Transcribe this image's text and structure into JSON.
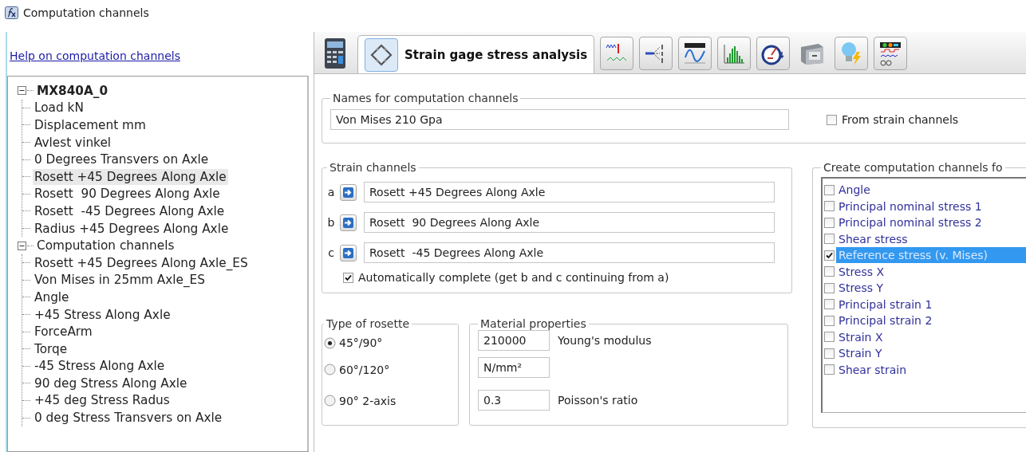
{
  "window": {
    "title": "Computation channels"
  },
  "help_link": "Help on computation channels",
  "tree": [
    {
      "label": "MX840A_0",
      "kind": "device",
      "expanded": true,
      "selected": false,
      "children": [
        {
          "label": "Load kN",
          "selected": false
        },
        {
          "label": "Displacement mm",
          "selected": false
        },
        {
          "label": "Avlest vinkel",
          "selected": false
        },
        {
          "label": "0 Degrees Transvers on Axle",
          "selected": false
        },
        {
          "label": "Rosett +45 Degrees Along Axle",
          "selected": true
        },
        {
          "label": "Rosett  90 Degrees Along Axle",
          "selected": false
        },
        {
          "label": "Rosett  -45 Degrees Along Axle",
          "selected": false
        },
        {
          "label": "Radius +45 Degrees Along Axle",
          "selected": false
        }
      ]
    },
    {
      "label": "Computation channels",
      "kind": "group",
      "expanded": true,
      "selected": false,
      "children": [
        {
          "label": "Rosett +45 Degrees Along Axle_ES",
          "selected": false
        },
        {
          "label": "Von Mises in 25mm Axle_ES",
          "selected": false
        },
        {
          "label": "Angle",
          "selected": false
        },
        {
          "label": "+45 Stress Along Axle",
          "selected": false
        },
        {
          "label": "ForceArm",
          "selected": false
        },
        {
          "label": "Torqe",
          "selected": false
        },
        {
          "label": "-45 Stress Along Axle",
          "selected": false
        },
        {
          "label": "90 deg Stress Along Axle",
          "selected": false
        },
        {
          "label": "+45 deg Stress Radus",
          "selected": false
        },
        {
          "label": "0 deg Stress Transvers on Axle",
          "selected": false
        }
      ]
    }
  ],
  "tabs": [
    {
      "kind": "icon",
      "selected": false
    },
    {
      "kind": "labeled",
      "label": "Strain gage stress analysis",
      "selected": true
    },
    {
      "kind": "icon",
      "selected": false
    },
    {
      "kind": "icon",
      "selected": false
    },
    {
      "kind": "icon",
      "selected": false
    },
    {
      "kind": "icon",
      "selected": false
    },
    {
      "kind": "icon",
      "selected": false
    },
    {
      "kind": "icon",
      "selected": false
    },
    {
      "kind": "icon",
      "selected": false
    },
    {
      "kind": "icon",
      "selected": false
    }
  ],
  "names": {
    "title": "Names for computation channels",
    "value": "Von Mises 210 Gpa",
    "from_strain": {
      "label": "From strain channels",
      "checked": false
    }
  },
  "strain_channels": {
    "title": "Strain channels",
    "rows": [
      {
        "letter": "a",
        "value": "Rosett +45 Degrees Along Axle"
      },
      {
        "letter": "b",
        "value": "Rosett  90 Degrees Along Axle"
      },
      {
        "letter": "c",
        "value": "Rosett  -45 Degrees Along Axle"
      }
    ],
    "auto_complete": {
      "label": "Automatically complete (get b and c continuing from a)",
      "checked": true
    }
  },
  "rosette": {
    "title": "Type of rosette",
    "options": [
      {
        "label": "45°/90°",
        "selected": true
      },
      {
        "label": "60°/120°",
        "selected": false
      },
      {
        "label": "90° 2-axis",
        "selected": false
      }
    ]
  },
  "material": {
    "title": "Material properties",
    "fields": [
      {
        "value": "210000",
        "label": "Young's modulus"
      },
      {
        "value": "N/mm²"
      },
      {
        "value": "0.3",
        "label": "Poisson's ratio"
      }
    ]
  },
  "create": {
    "title": "Create computation channels fo",
    "items": [
      {
        "label": "Angle",
        "checked": false,
        "selected": false
      },
      {
        "label": "Principal nominal stress 1",
        "checked": false,
        "selected": false
      },
      {
        "label": "Principal nominal stress 2",
        "checked": false,
        "selected": false
      },
      {
        "label": "Shear stress",
        "checked": false,
        "selected": false
      },
      {
        "label": "Reference stress (v. Mises)",
        "checked": true,
        "selected": true
      },
      {
        "label": "Stress X",
        "checked": false,
        "selected": false
      },
      {
        "label": "Stress Y",
        "checked": false,
        "selected": false
      },
      {
        "label": "Principal strain 1",
        "checked": false,
        "selected": false
      },
      {
        "label": "Principal strain 2",
        "checked": false,
        "selected": false
      },
      {
        "label": "Strain X",
        "checked": false,
        "selected": false
      },
      {
        "label": "Strain Y",
        "checked": false,
        "selected": false
      },
      {
        "label": "Shear strain",
        "checked": false,
        "selected": false
      }
    ]
  }
}
